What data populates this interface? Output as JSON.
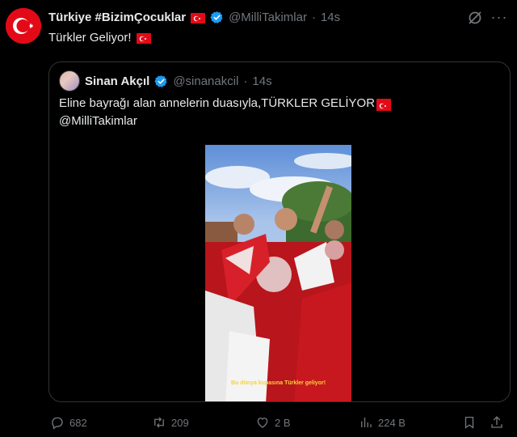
{
  "tweet": {
    "author_name": "Türkiye #BizimÇocuklar",
    "handle": "@MilliTakimlar",
    "separator": "·",
    "time": "14s",
    "text": "Türkler Geliyor!"
  },
  "quote": {
    "author_name": "Sinan Akçıl",
    "handle": "@sinanakcil",
    "separator": "·",
    "time": "14s",
    "text_line1": "Eline bayrağı alan annelerin duasıyla,TÜRKLER GELİYOR",
    "text_line2": "@MilliTakimlar",
    "video_caption": "Bu dünya kupasına Türkler geliyor!"
  },
  "actions": {
    "replies": "682",
    "reposts": "209",
    "likes": "2 B",
    "views": "224 B"
  },
  "icons": {
    "avatar": "turkish-flag-icon",
    "verified": "verified-badge-icon",
    "grok": "grok-icon",
    "more": "more-icon",
    "reply": "reply-icon",
    "repost": "repost-icon",
    "like": "heart-icon",
    "views": "views-icon",
    "bookmark": "bookmark-icon",
    "share": "share-icon"
  },
  "colors": {
    "background": "#000000",
    "text": "#e7e9ea",
    "muted": "#71767b",
    "verified": "#1d9bf0",
    "flag_red": "#e30a17",
    "border": "#2f3336"
  }
}
